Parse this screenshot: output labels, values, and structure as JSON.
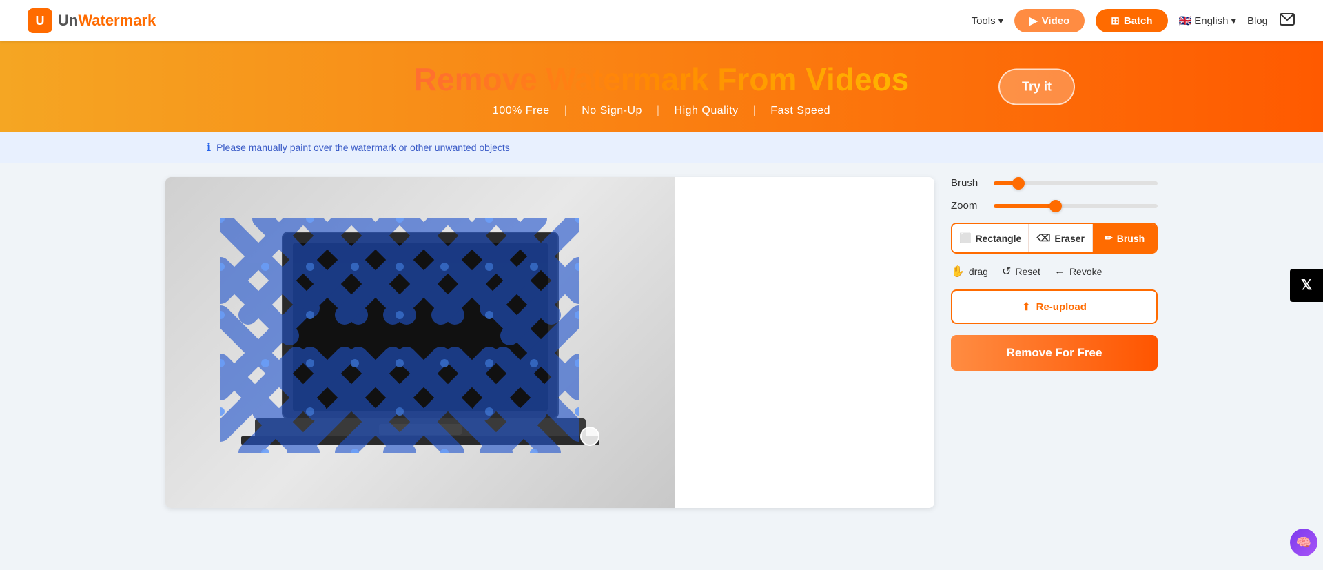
{
  "logo": {
    "box_text": "U",
    "un_text": "Un",
    "watermark_text": "Watermark"
  },
  "nav": {
    "tools_label": "Tools",
    "video_label": "Video",
    "batch_label": "Batch",
    "language_label": "English",
    "blog_label": "Blog"
  },
  "hero": {
    "title": "Remove Watermark From Videos",
    "subtitle_free": "100% Free",
    "subtitle_nosignup": "No Sign-Up",
    "subtitle_quality": "High Quality",
    "subtitle_speed": "Fast Speed",
    "try_label": "Try it"
  },
  "info_bar": {
    "message": "Please manually paint over the watermark or other unwanted objects"
  },
  "tools": {
    "brush_label": "Brush",
    "zoom_label": "Zoom",
    "brush_value": 15,
    "zoom_value": 38,
    "rectangle_label": "Rectangle",
    "eraser_label": "Eraser",
    "brush_tool_label": "Brush",
    "drag_label": "drag",
    "reset_label": "Reset",
    "revoke_label": "Revoke",
    "reupload_label": "Re-upload",
    "remove_label": "Remove For Free"
  },
  "social": {
    "x_label": "𝕏",
    "ai_label": "🧠"
  }
}
